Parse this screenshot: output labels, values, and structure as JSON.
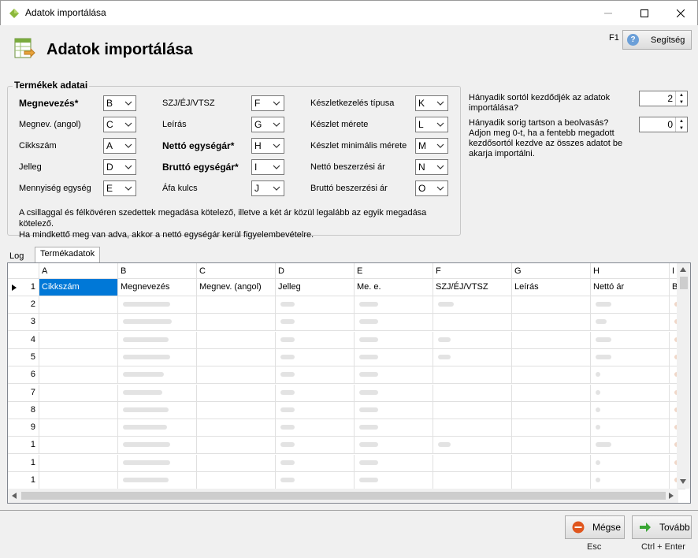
{
  "window": {
    "title": "Adatok importálása"
  },
  "header": {
    "title": "Adatok importálása",
    "f1": "F1",
    "help_label": "Segítség"
  },
  "group": {
    "legend": "Termékek adatai",
    "fields": [
      {
        "label": "Megnevezés*",
        "value": "B",
        "bold": true
      },
      {
        "label": "Megnev. (angol)",
        "value": "C",
        "bold": false
      },
      {
        "label": "Cikkszám",
        "value": "A",
        "bold": false
      },
      {
        "label": "Jelleg",
        "value": "D",
        "bold": false
      },
      {
        "label": "Mennyiség egység",
        "value": "E",
        "bold": false
      },
      {
        "label": "SZJ/ÉJ/VTSZ",
        "value": "F",
        "bold": false
      },
      {
        "label": "Leírás",
        "value": "G",
        "bold": false
      },
      {
        "label": "Nettó egységár*",
        "value": "H",
        "bold": true
      },
      {
        "label": "Bruttó egységár*",
        "value": "I",
        "bold": true
      },
      {
        "label": "Áfa kulcs",
        "value": "J",
        "bold": false
      },
      {
        "label": "Készletkezelés típusa",
        "value": "K",
        "bold": false
      },
      {
        "label": "Készlet mérete",
        "value": "L",
        "bold": false
      },
      {
        "label": "Készlet minimális mérete",
        "value": "M",
        "bold": false
      },
      {
        "label": "Nettó beszerzési ár",
        "value": "N",
        "bold": false
      },
      {
        "label": "Bruttó beszerzési ár",
        "value": "O",
        "bold": false
      }
    ],
    "note_line1": "A csillaggal és félkövéren szedettek megadása kötelező, illetve a két ár közül legalább az egyik megadása kötelező.",
    "note_line2": "Ha mindkettő meg van adva, akkor a nettó egységár kerül figyelembevételre."
  },
  "options": {
    "start_row_label": "Hányadik sortól kezdődjék az adatok importálása?",
    "start_row_value": "2",
    "end_row_label": "Hányadik sorig tartson a beolvasás? Adjon meg 0-t, ha a fentebb megadott kezdősortól kezdve az összes adatot be akarja importálni.",
    "end_row_value": "0"
  },
  "tabs": [
    {
      "label": "Log"
    },
    {
      "label": "Termékadatok"
    }
  ],
  "grid": {
    "columns": [
      "A",
      "B",
      "C",
      "D",
      "E",
      "F",
      "G",
      "H",
      "I"
    ],
    "header_row": {
      "number": "1",
      "cells": [
        "Cikkszám",
        "Megnevezés",
        "Megnev. (angol)",
        "Jelleg",
        "Me. e.",
        "SZJ/ÉJ/VTSZ",
        "Leírás",
        "Nettó ár",
        "B"
      ]
    },
    "row_numbers": [
      "2",
      "3",
      "4",
      "5",
      "6",
      "7",
      "8",
      "9",
      "1",
      "1",
      "1"
    ]
  },
  "footer": {
    "cancel_label": "Mégse",
    "cancel_shortcut": "Esc",
    "next_label": "Tovább",
    "next_shortcut": "Ctrl + Enter"
  },
  "colors": {
    "selection": "#0078d7",
    "cancel": "#e0561e",
    "next": "#3aa635"
  }
}
